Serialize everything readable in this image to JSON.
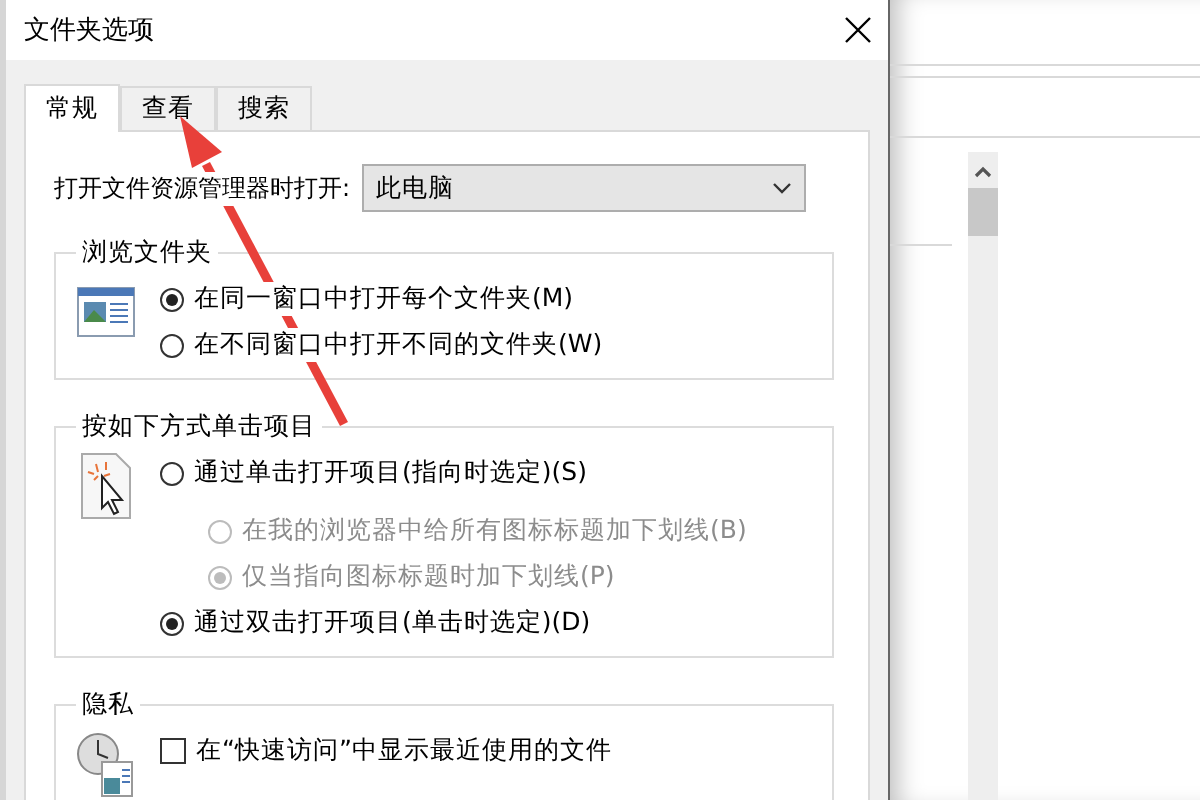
{
  "window": {
    "title": "文件夹选项"
  },
  "tabs": [
    {
      "label": "常规",
      "selected": true
    },
    {
      "label": "查看",
      "selected": false
    },
    {
      "label": "搜索",
      "selected": false
    }
  ],
  "open_in": {
    "label": "打开文件资源管理器时打开:",
    "value": "此电脑"
  },
  "groups": [
    {
      "title": "浏览文件夹",
      "options": [
        {
          "kind": "radio",
          "label": "在同一窗口中打开每个文件夹(M)",
          "selected": true,
          "disabled": false
        },
        {
          "kind": "radio",
          "label": "在不同窗口中打开不同的文件夹(W)",
          "selected": false,
          "disabled": false
        }
      ]
    },
    {
      "title": "按如下方式单击项目",
      "options": [
        {
          "kind": "radio",
          "label": "通过单击打开项目(指向时选定)(S)",
          "selected": false,
          "disabled": false,
          "children": [
            {
              "kind": "radio",
              "label": "在我的浏览器中给所有图标标题加下划线(B)",
              "selected": false,
              "disabled": true
            },
            {
              "kind": "radio",
              "label": "仅当指向图标标题时加下划线(P)",
              "selected": true,
              "disabled": true
            }
          ]
        },
        {
          "kind": "radio",
          "label": "通过双击打开项目(单击时选定)(D)",
          "selected": true,
          "disabled": false
        }
      ]
    },
    {
      "title": "隐私",
      "options": [
        {
          "kind": "checkbox",
          "label": "在“快速访问”中显示最近使用的文件",
          "checked": false,
          "disabled": false
        }
      ]
    }
  ]
}
